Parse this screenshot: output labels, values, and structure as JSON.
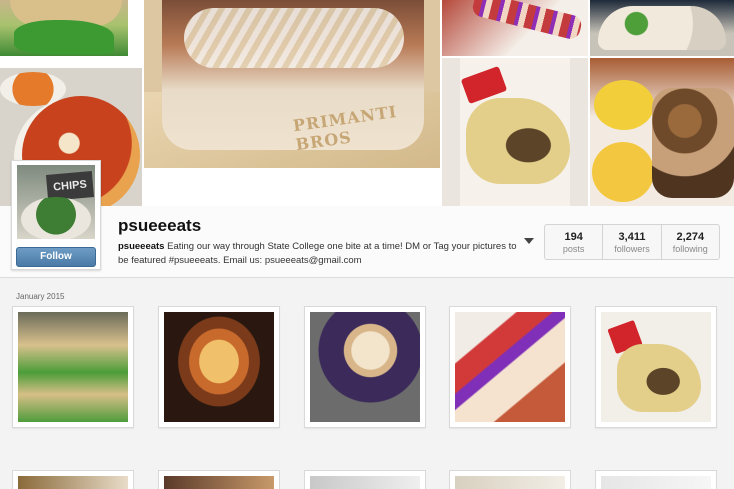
{
  "profile": {
    "username": "psueeeats",
    "bio_handle": "psueeeats",
    "bio_text": "Eating our way through State College one bite at a time! DM or Tag your pictures to be featured #psueeeats. Email us: psueeeats@gmail.com",
    "follow_label": "Follow"
  },
  "stats": [
    {
      "value": "194",
      "label": "posts"
    },
    {
      "value": "3,411",
      "label": "followers"
    },
    {
      "value": "2,274",
      "label": "following"
    }
  ],
  "cover": {
    "avatar_sign": "CHIPS",
    "sandwich_logo": "PRIMANTI BROS"
  },
  "grid": {
    "month_label": "January 2015"
  }
}
